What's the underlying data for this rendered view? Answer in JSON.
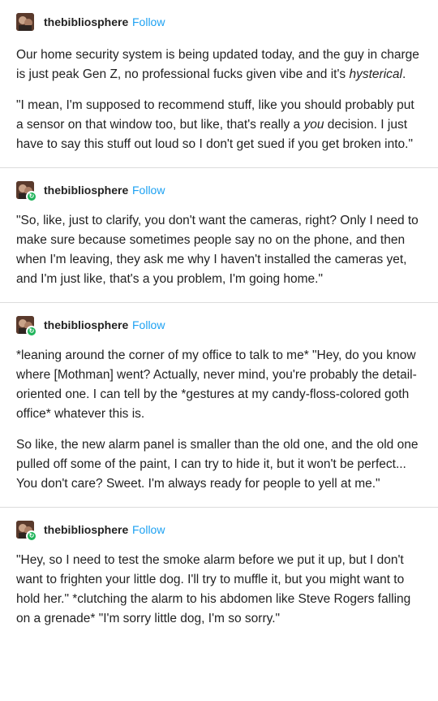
{
  "posts": [
    {
      "blog_name": "thebibliosphere",
      "follow_label": "Follow",
      "avatar_badge": false,
      "paragraphs": [
        {
          "before": "Our home security system is being updated today, and the guy in charge is just peak Gen Z, no professional fucks given vibe and it's ",
          "em": "hysterical",
          "after": "."
        },
        {
          "before": "\"I mean, I'm supposed to recommend stuff, like you should probably put a sensor on that window too, but like, that's really a ",
          "em": "you",
          "after": " decision. I just have to say this stuff out loud so I don't get sued if you get broken into.\""
        }
      ]
    },
    {
      "blog_name": "thebibliosphere",
      "follow_label": "Follow",
      "avatar_badge": true,
      "paragraphs": [
        {
          "before": "\"So, like, just to clarify, you don't want the cameras, right? Only I need to make sure because sometimes people say no on the phone, and then when I'm leaving, they ask me why I haven't installed the cameras yet, and I'm just like, that's a you problem, I'm going home.\"",
          "em": "",
          "after": ""
        }
      ]
    },
    {
      "blog_name": "thebibliosphere",
      "follow_label": "Follow",
      "avatar_badge": true,
      "paragraphs": [
        {
          "before": "*leaning around the corner of my office to talk to me* \"Hey, do you know where [Mothman] went? Actually, never mind, you're probably the detail-oriented one. I can tell by the *gestures at my candy-floss-colored goth office* whatever this is.",
          "em": "",
          "after": ""
        },
        {
          "before": "So like, the new alarm panel is smaller than the old one, and the old one pulled off some of the paint, I can try to hide it, but it won't be perfect... You don't care? Sweet. I'm always ready for people to yell at me.\"",
          "em": "",
          "after": ""
        }
      ]
    },
    {
      "blog_name": "thebibliosphere",
      "follow_label": "Follow",
      "avatar_badge": true,
      "paragraphs": [
        {
          "before": "\"Hey, so I need to test the smoke alarm before we put it up, but I don't want to frighten your little dog. I'll try to muffle it, but you might want to hold her.\" *clutching the alarm to his abdomen like Steve Rogers falling on a grenade* \"I'm sorry little dog, I'm so sorry.\"",
          "em": "",
          "after": ""
        }
      ]
    }
  ]
}
